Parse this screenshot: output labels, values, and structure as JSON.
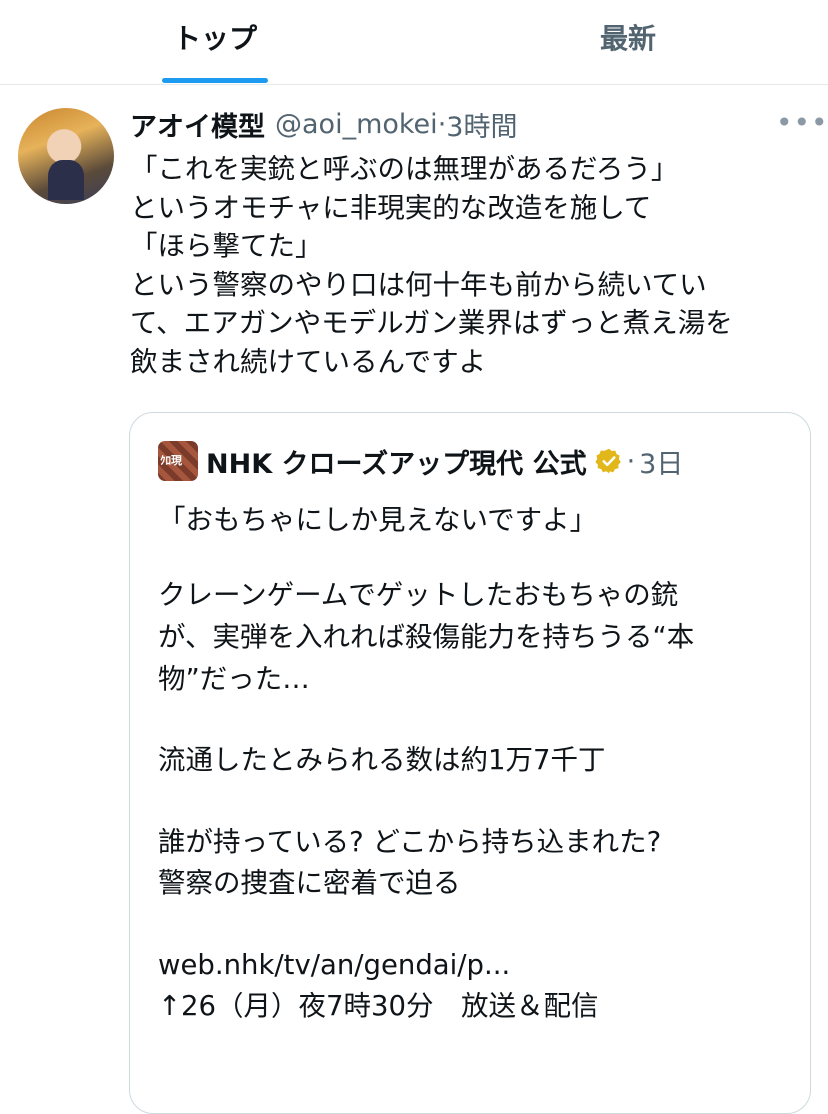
{
  "tabs": [
    {
      "label": "トップ",
      "active": true
    },
    {
      "label": "最新",
      "active": false
    }
  ],
  "colors": {
    "accent": "#1d9bf0",
    "secondary_text": "#536471",
    "verified": "#e2b719"
  },
  "tweet": {
    "author_name": "アオイ模型",
    "handle": "@aoi_mokei",
    "separator": "·",
    "time": "3時間",
    "more_icon": "more-horizontal-icon",
    "lines": [
      "「これを実銃と呼ぶのは無理があるだろう」",
      "というオモチャに非現実的な改造を施して",
      "「ほら撃てた」",
      "という警察のやり口は何十年も前から続いてい",
      "て、エアガンやモデルガン業界はずっと煮え湯を",
      "飲まされ続けているんですよ"
    ]
  },
  "quote": {
    "avatar_text": "ｸﾛ現",
    "author_name": "NHK クローズアップ現代 公式",
    "badge_icon": "verified-badge-icon",
    "separator": "·",
    "time": "3日",
    "lines": [
      "「おもちゃにしか見えないですよ」",
      "クレーンゲームでゲットしたおもちゃの銃",
      "が、実弾を入れれば殺傷能力を持ちうる“本",
      "物”だった…",
      "流通したとみられる数は約1万7千丁",
      "誰が持っている? どこから持ち込まれた?",
      "警察の捜査に密着で迫る",
      "web.nhk/tv/an/gendai/p...",
      "↑26（月）夜7時30分　放送＆配信"
    ]
  }
}
